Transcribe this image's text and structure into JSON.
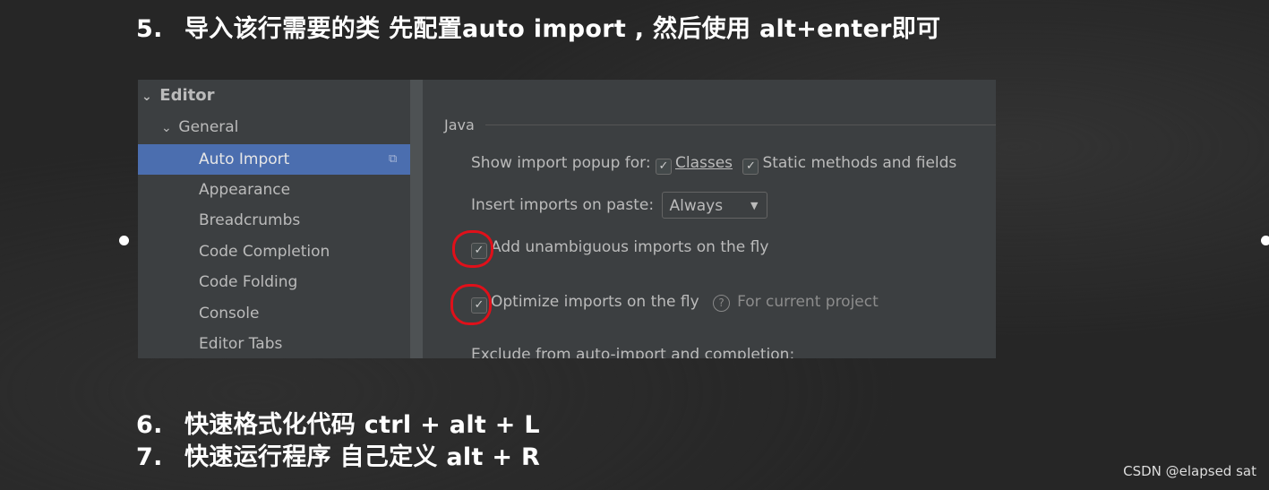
{
  "steps": [
    {
      "num": "5.",
      "text": "导入该行需要的类 先配置auto import , 然后使用 alt+enter即可"
    },
    {
      "num": "6.",
      "text": "快速格式化代码 ctrl + alt + L"
    },
    {
      "num": "7.",
      "text": "快速运行程序 自己定义 alt + R"
    }
  ],
  "sidebar": {
    "items": [
      {
        "label": "Editor",
        "level": 0,
        "expanded": true
      },
      {
        "label": "General",
        "level": 1,
        "expanded": true
      },
      {
        "label": "Auto Import",
        "level": 2,
        "selected": true
      },
      {
        "label": "Appearance",
        "level": 2
      },
      {
        "label": "Breadcrumbs",
        "level": 2
      },
      {
        "label": "Code Completion",
        "level": 2
      },
      {
        "label": "Code Folding",
        "level": 2
      },
      {
        "label": "Console",
        "level": 2
      },
      {
        "label": "Editor Tabs",
        "level": 2
      }
    ]
  },
  "content": {
    "section": "Java",
    "popup_label": "Show import popup for:",
    "classes_label": "Classes",
    "classes_checked": true,
    "static_label": "Static methods and fields",
    "static_checked": true,
    "paste_label": "Insert imports on paste:",
    "paste_value": "Always",
    "unambiguous_label": "Add unambiguous imports on the fly",
    "unambiguous_checked": true,
    "optimize_label": "Optimize imports on the fly",
    "optimize_checked": true,
    "optimize_hint": "For current project",
    "exclude_label": "Exclude from auto-import and completion:"
  },
  "watermark": "CSDN @elapsed sat",
  "colors": {
    "selection": "#4b6eaf",
    "annotation": "#e0101a",
    "panel": "#3c3f41"
  }
}
